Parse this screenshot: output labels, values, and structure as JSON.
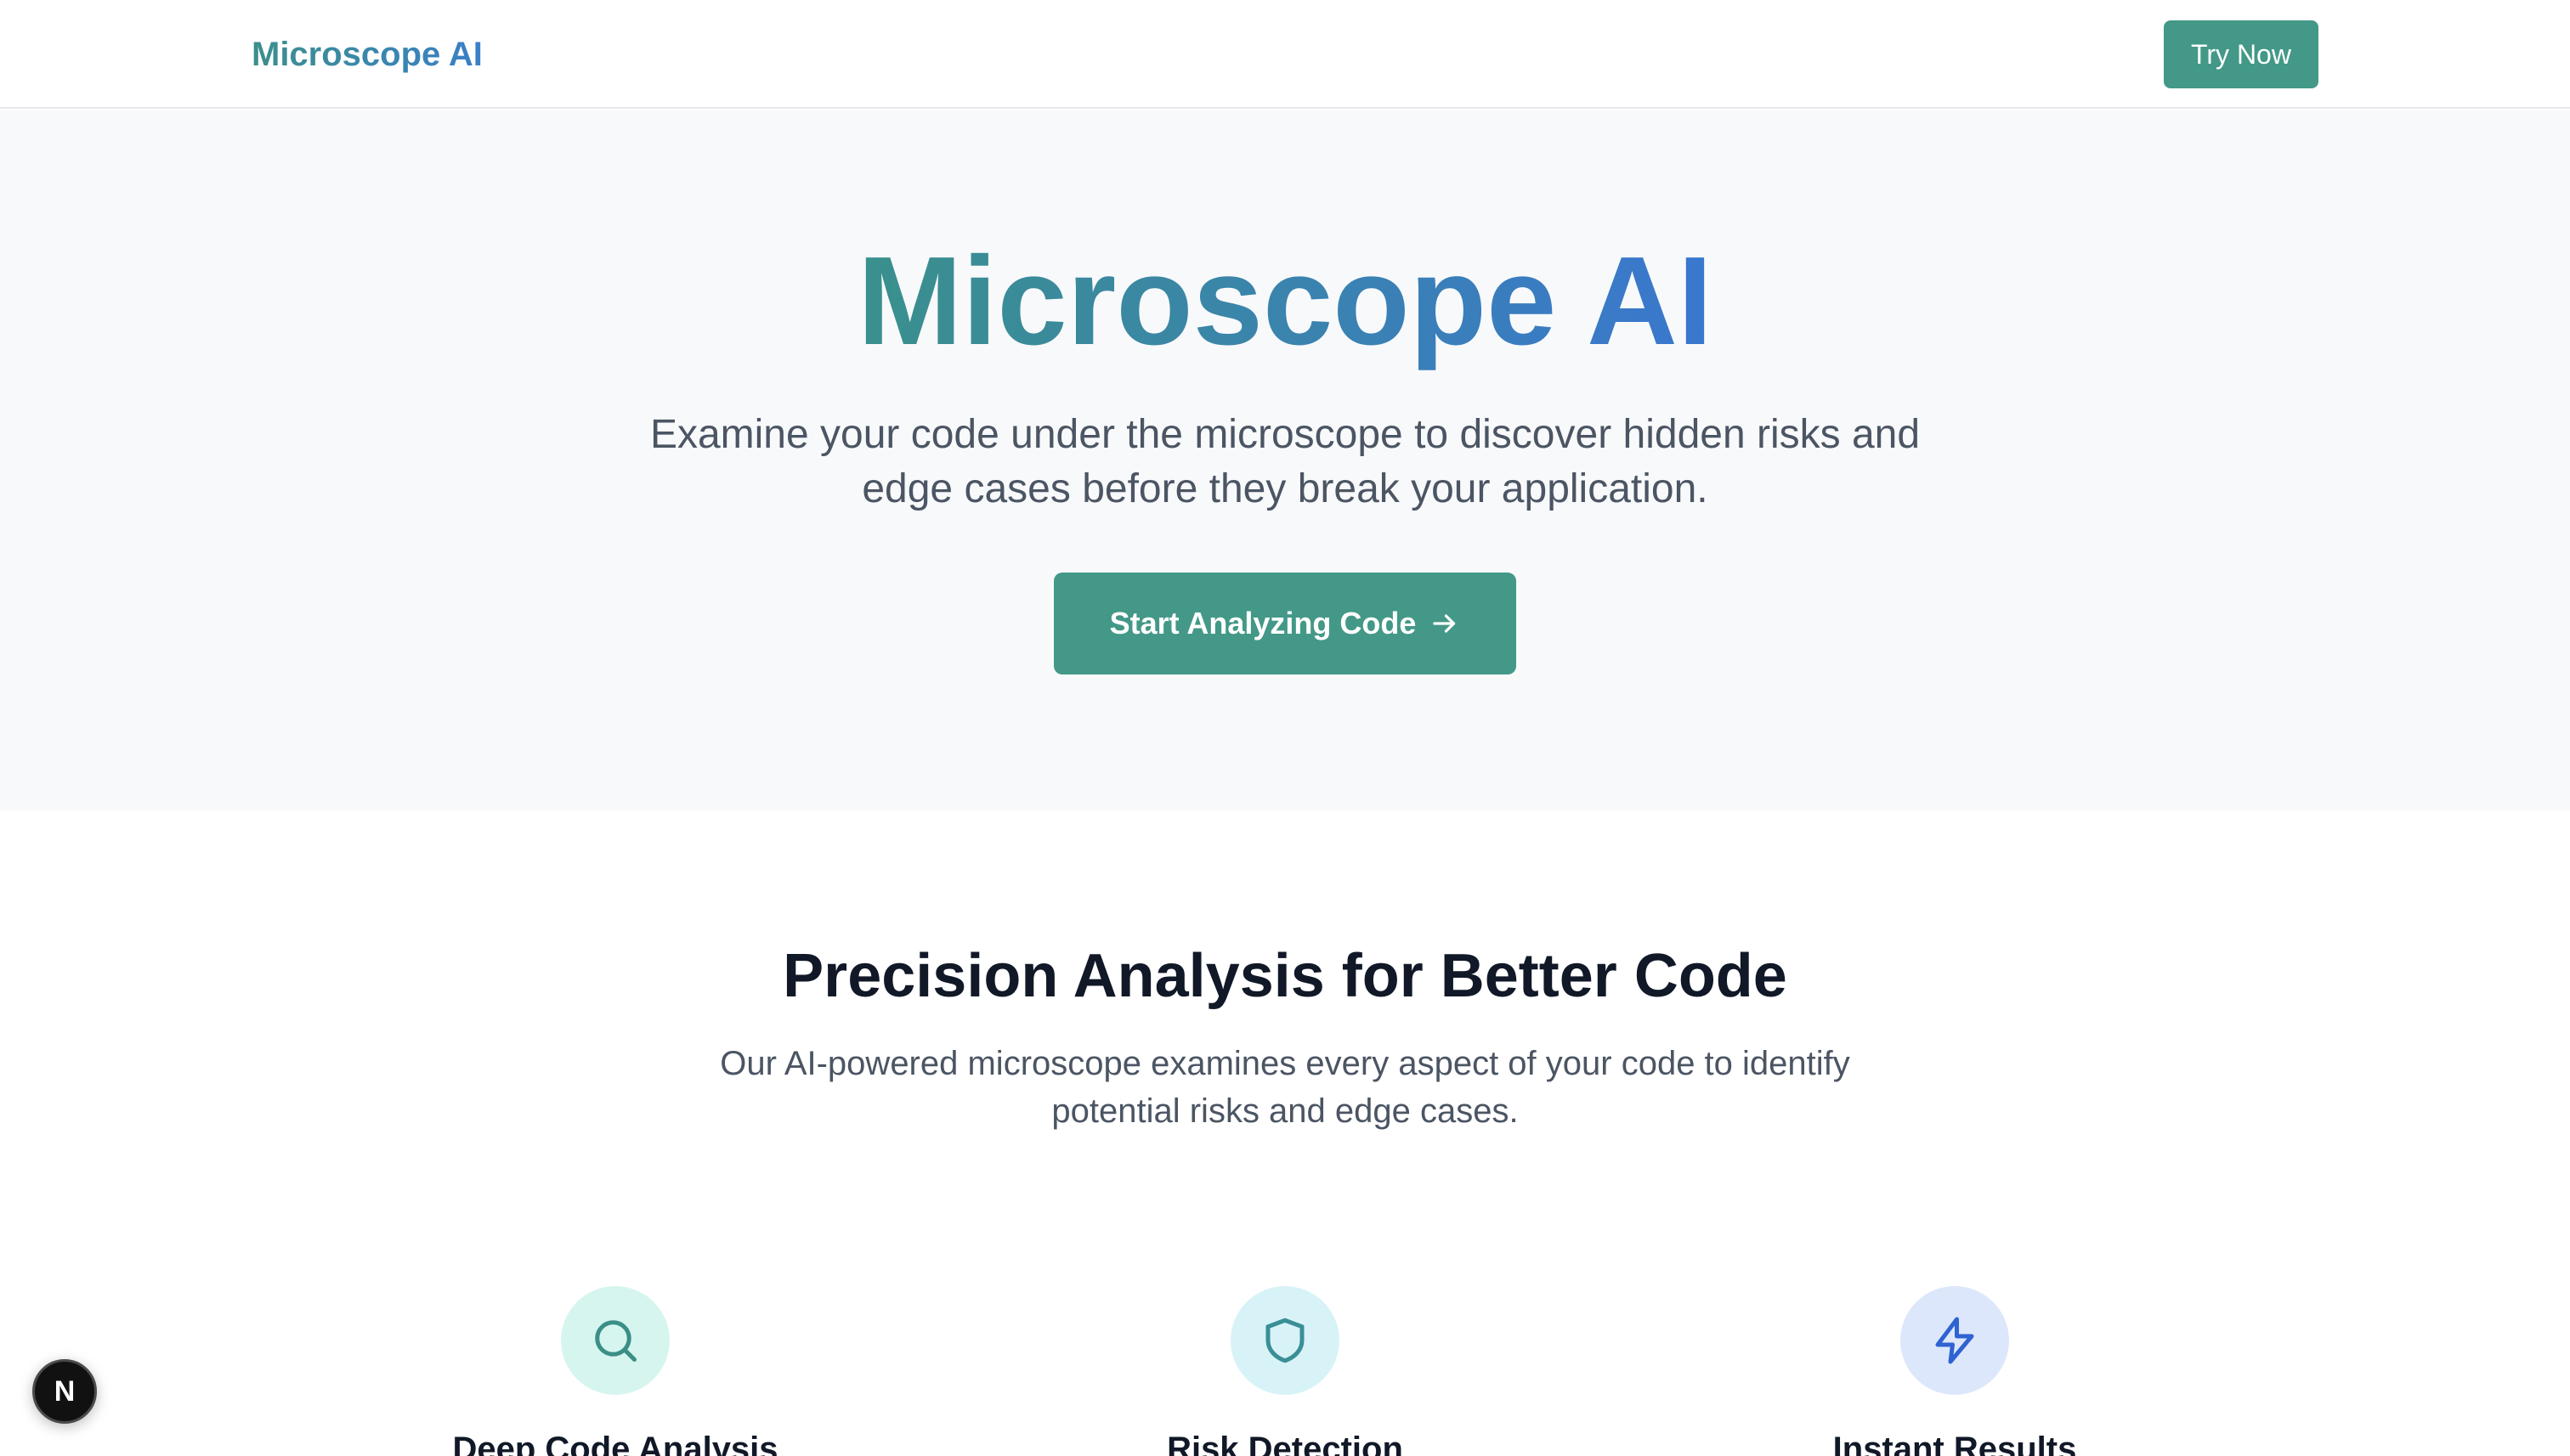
{
  "header": {
    "logo": "Microscope AI",
    "cta_label": "Try Now"
  },
  "hero": {
    "title": "Microscope AI",
    "subtitle": "Examine your code under the microscope to discover hidden risks and edge cases before they break your application.",
    "cta_label": "Start Analyzing Code",
    "cta_icon": "arrow-right-icon"
  },
  "features": {
    "title": "Precision Analysis for Better Code",
    "subtitle": "Our AI-powered microscope examines every aspect of your code to identify potential risks and edge cases.",
    "items": [
      {
        "title": "Deep Code Analysis",
        "icon": "search-icon",
        "icon_bg": "#d6f5ee",
        "icon_color": "#3a8f86"
      },
      {
        "title": "Risk Detection",
        "icon": "shield-icon",
        "icon_bg": "#d8f3f7",
        "icon_color": "#3a8f96"
      },
      {
        "title": "Instant Results",
        "icon": "lightning-icon",
        "icon_bg": "#dde7fb",
        "icon_color": "#2f63d2"
      }
    ]
  },
  "dev_badge": {
    "label": "N",
    "icon": "nextjs-icon"
  },
  "colors": {
    "accent": "#439887",
    "gradient_start": "#3a908c",
    "gradient_end": "#3a77cf",
    "hero_bg": "#f8f9fb"
  }
}
